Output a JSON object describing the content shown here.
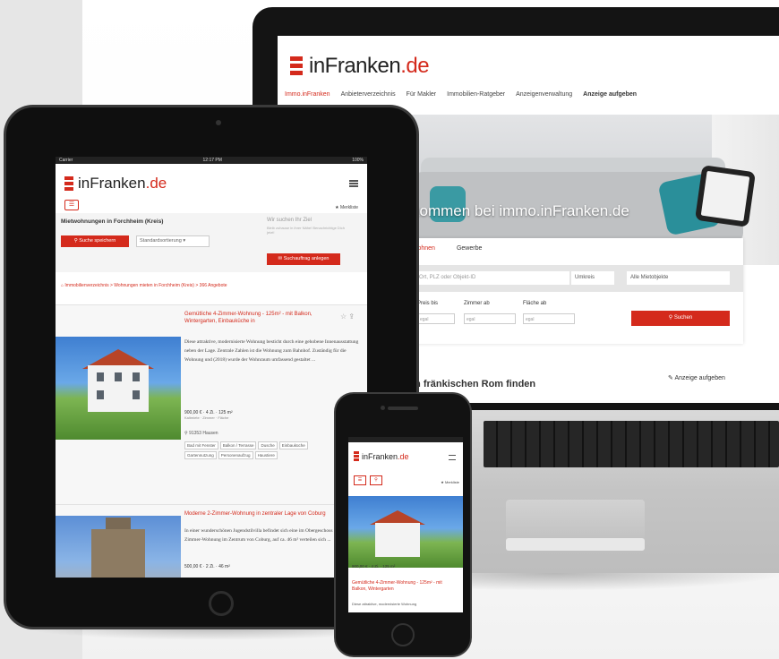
{
  "brand": {
    "name_plain": "inFranken",
    "name_accent": ".de",
    "accent_color": "#d42a1c"
  },
  "laptop": {
    "nav": [
      "Immo.inFranken",
      "Anbieterverzeichnis",
      "Für Makler",
      "Immobilien-Ratgeber",
      "Anzeigenverwaltung",
      "Anzeige aufgeben"
    ],
    "hero_text": "kommen bei immo.inFranken.de",
    "tabs": [
      "Wohnen",
      "Gewerbe"
    ],
    "search_placeholder": "Ort, PLZ oder Objekt-ID",
    "radius": "Umkreis",
    "category": "Alle Mietobjekte",
    "filters": [
      "Preis bis",
      "Zimmer ab",
      "Fläche ab"
    ],
    "filter_placeholder": "egal",
    "search_button": "Suchen",
    "heading": "m fränkischen Rom finden",
    "post_ad": "Anzeige aufgeben"
  },
  "tablet": {
    "status_left": "Carrier",
    "status_time": "12:17 PM",
    "status_right": "100%",
    "watchlist": "Merkliste",
    "section_title": "Mietwohnungen in Forchheim (Kreis)",
    "save_search": "Suche speichern",
    "sort": "Standardsortierung",
    "wanted_title": "Wir suchen Ihr Ziel",
    "wanted_sub": "Bleib zuhause in ihrer Nähe! Benachrichtige Dich jetzt!",
    "wanted_button": "Suchauftrag anlegen",
    "breadcrumb": "Immobilienverzeichnis > Wohnungen mieten in Forchheim (Kreis) > 366 Angebote",
    "listing1": {
      "title": "Gemütliche 4-Zimmer-Wohnung - 125m² - mit Balkon, Wintergarten, Einbauküche in",
      "desc": "Diese attraktive, modernisierte Wohnung besticht durch eine gehobene Innenausstattung neben der Lage. Zentrale Zahlen ist die Wohnung zum Bahnhof. Zuständig für die Wohnung und (2018) wurde der Wohnraum umfassend gestaltet ...",
      "price": "900,00 € · 4 Zi. · 125 m²",
      "price_sub": "Kaltmiete · Zimmer · Fläche",
      "location": "91353 Hausen",
      "tags": [
        "Bad mit Fenster",
        "Balkon / Terrasse",
        "Dusche",
        "Einbauküche",
        "Gartennutzung",
        "Personenaufzug",
        "Haustiere"
      ]
    },
    "listing2": {
      "title": "Moderne 2-Zimmer-Wohnung in zentraler Lage von Coburg",
      "desc": "In einer wunderschönen Jugendstilvilla befindet sich eine im Obergeschoss diese 2-Zimmer-Wohnung im Zentrum von Coburg, auf ca. 46 m² verteilen sich ...",
      "price": "500,00 € · 2 Zi. · 46 m²"
    }
  },
  "phone": {
    "watchlist": "Merkliste",
    "price": "900,00 € · 4 Zi. · 125 m²",
    "title": "Gemütliche 4-Zimmer-Wohnung - 125m² - mit Balkon, Wintergarten",
    "desc": "Diese attraktive, modernisierte Wohnung"
  }
}
